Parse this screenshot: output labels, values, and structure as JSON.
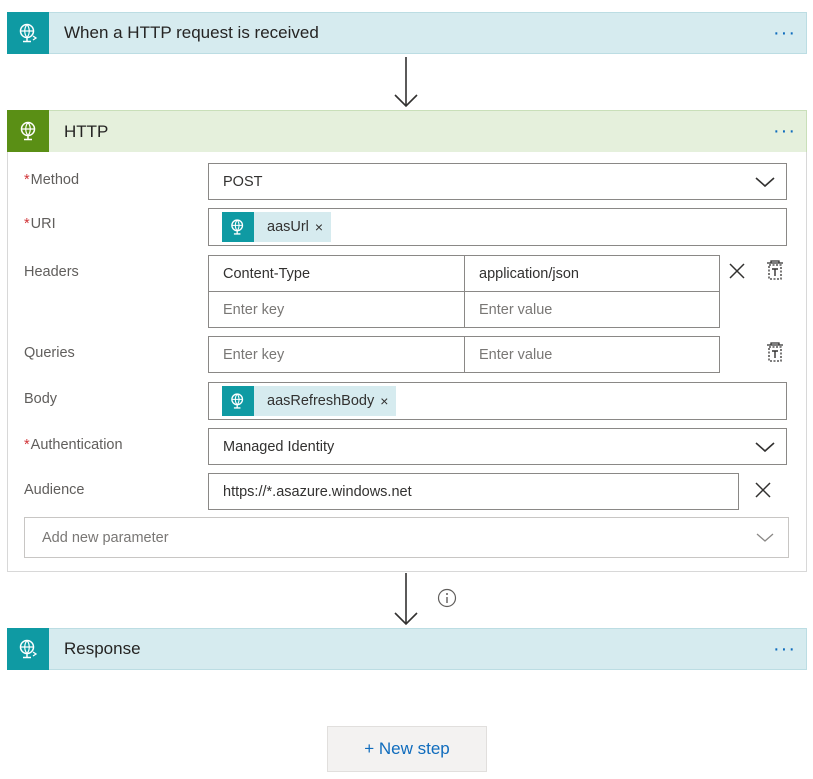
{
  "trigger": {
    "title": "When a HTTP request is received",
    "more": "···"
  },
  "http": {
    "title": "HTTP",
    "more": "···",
    "method": {
      "label": "Method",
      "required": "*",
      "value": "POST"
    },
    "uri": {
      "label": "URI",
      "required": "*",
      "token": "aasUrl",
      "token_remove": "×"
    },
    "headers": {
      "label": "Headers",
      "rows": [
        {
          "key": "Content-Type",
          "value": "application/json"
        },
        {
          "key_placeholder": "Enter key",
          "value_placeholder": "Enter value"
        }
      ]
    },
    "queries": {
      "label": "Queries",
      "key_placeholder": "Enter key",
      "value_placeholder": "Enter value"
    },
    "body": {
      "label": "Body",
      "token": "aasRefreshBody",
      "token_remove": "×"
    },
    "authentication": {
      "label": "Authentication",
      "required": "*",
      "value": "Managed Identity"
    },
    "audience": {
      "label": "Audience",
      "value": "https://*.asazure.windows.net"
    },
    "add_param": {
      "placeholder": "Add new parameter"
    }
  },
  "connector_info_icon": "info-icon",
  "response": {
    "title": "Response",
    "more": "···"
  },
  "new_step": {
    "label": "+ New step"
  },
  "colors": {
    "teal_icon": "#0f9aa3",
    "green_icon": "#5a8f15",
    "teal_header": "#d6ebef",
    "green_header": "#e5f0dc",
    "accent": "#0f6cbd",
    "required": "#d13438"
  }
}
